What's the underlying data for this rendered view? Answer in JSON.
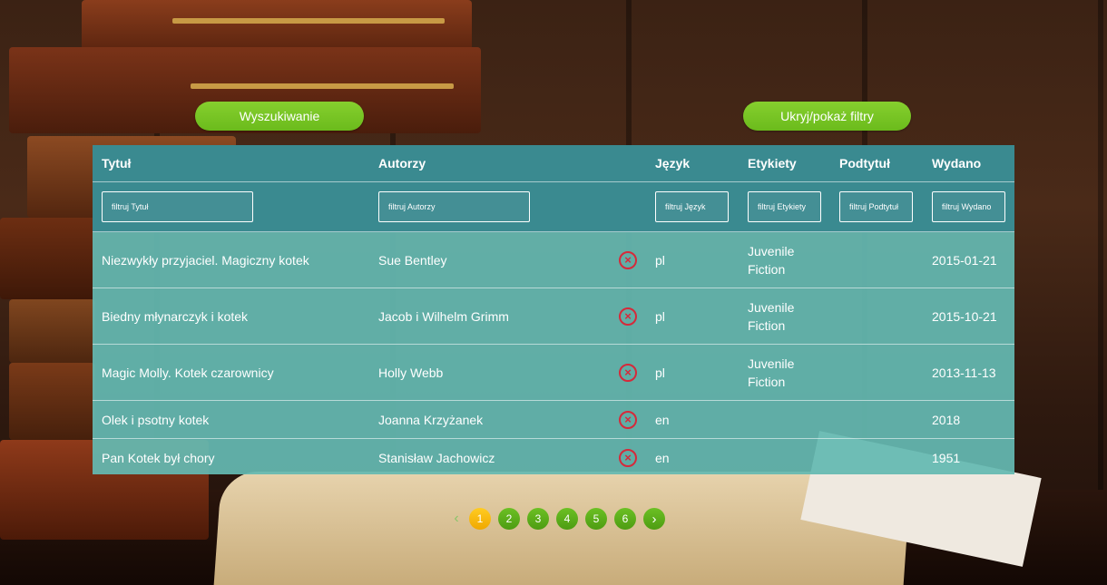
{
  "buttons": {
    "search": "Wyszukiwanie",
    "toggle_filters": "Ukryj/pokaż filtry"
  },
  "table": {
    "columns": [
      "Tytuł",
      "Autorzy",
      "Język",
      "Etykiety",
      "Podtytuł",
      "Wydano"
    ],
    "filters": {
      "title": "filtruj Tytuł",
      "authors": "filtruj Autorzy",
      "language": "filtruj Język",
      "tags": "filtruj Etykiety",
      "subtitle": "filtruj Podtytuł",
      "published": "filtruj Wydano"
    },
    "rows": [
      {
        "title": "Niezwykły przyjaciel. Magiczny kotek",
        "authors": "Sue Bentley",
        "language": "pl",
        "tags": "Juvenile Fiction",
        "subtitle": "",
        "published": "2015-01-21"
      },
      {
        "title": "Biedny młynarczyk i kotek",
        "authors": "Jacob i Wilhelm Grimm",
        "language": "pl",
        "tags": "Juvenile Fiction",
        "subtitle": "",
        "published": "2015-10-21"
      },
      {
        "title": "Magic Molly. Kotek czarownicy",
        "authors": "Holly Webb",
        "language": "pl",
        "tags": "Juvenile Fiction",
        "subtitle": "",
        "published": "2013-11-13"
      },
      {
        "title": "Olek i psotny kotek",
        "authors": "Joanna Krzyżanek",
        "language": "en",
        "tags": "",
        "subtitle": "",
        "published": "2018"
      },
      {
        "title": "Pan Kotek był chory",
        "authors": "Stanisław Jachowicz",
        "language": "en",
        "tags": "",
        "subtitle": "",
        "published": "1951"
      }
    ]
  },
  "pagination": {
    "prev": "‹",
    "pages": [
      "1",
      "2",
      "3",
      "4",
      "5",
      "6"
    ],
    "current": "1",
    "next": "›"
  },
  "colors": {
    "accent": "#74c021",
    "table_header": "#3a8a90",
    "table_body": "#64b9b2",
    "delete": "#d6293a",
    "active_page": "#f5b400"
  }
}
